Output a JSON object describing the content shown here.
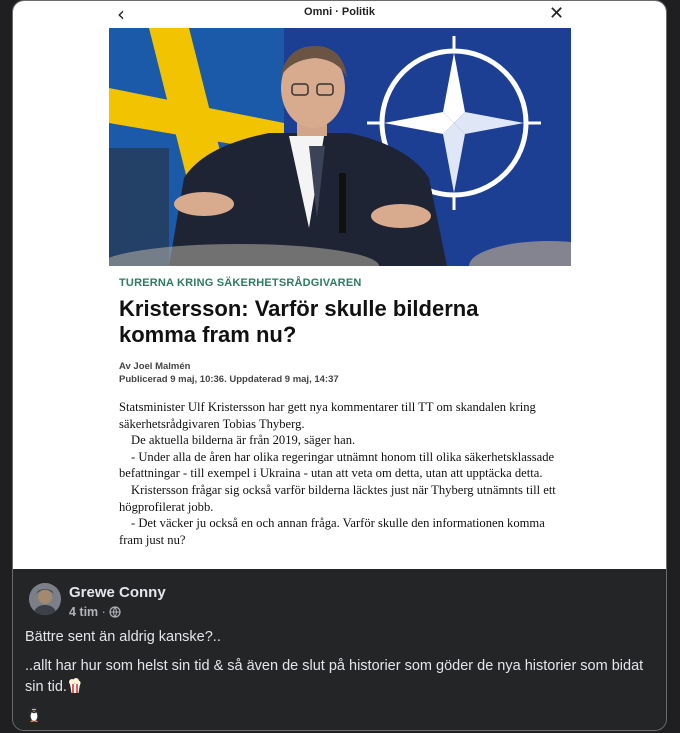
{
  "screenshot": {
    "nav": {
      "back_glyph": "‹",
      "title": "Omni · Politik",
      "close_glyph": "✕"
    },
    "photo": {
      "description_icon": "press-photo"
    },
    "article": {
      "kicker": "TURERNA KRING SÄKERHETSRÅDGIVAREN",
      "headline": "Kristersson: Varför skulle bilderna komma fram nu?",
      "author": "Av Joel Malmén",
      "published": "Publicerad 9 maj, 10:36. Uppdaterad 9 maj, 14:37",
      "paragraphs": [
        "Statsminister Ulf Kristersson har gett nya kommentarer till TT om skandalen kring säkerhetsrådgivaren Tobias Thyberg.",
        "De aktuella bilderna är från 2019, säger han.",
        "- Under alla de åren har olika regeringar utnämnt honom till olika säkerhetsklassade befattningar - till exempel i Ukraina - utan att veta om detta, utan att upptäcka detta.",
        "Kristersson frågar sig också varför bilderna läcktes just när Thyberg utnämnts till ett högprofilerat jobb.",
        "- Det väcker ju också en och annan fråga. Varför skulle den informationen komma fram just nu?"
      ]
    }
  },
  "post": {
    "author": "Grewe Conny",
    "time": "4 tim",
    "separator": "·",
    "text1": "Bättre sent än aldrig kanske?..",
    "text2": "..allt har hur som helst sin tid & så även de slut på historier som göder de nya historier som bidat sin tid.",
    "emoji_popcorn": "popcorn-icon",
    "emoji_penguin": "penguin-icon"
  },
  "colors": {
    "kicker": "#2f7a63",
    "flag_blue": "#1b5aa8",
    "flag_yellow": "#f2c300",
    "nato_blue": "#1c3f94",
    "post_bg": "#242527"
  }
}
